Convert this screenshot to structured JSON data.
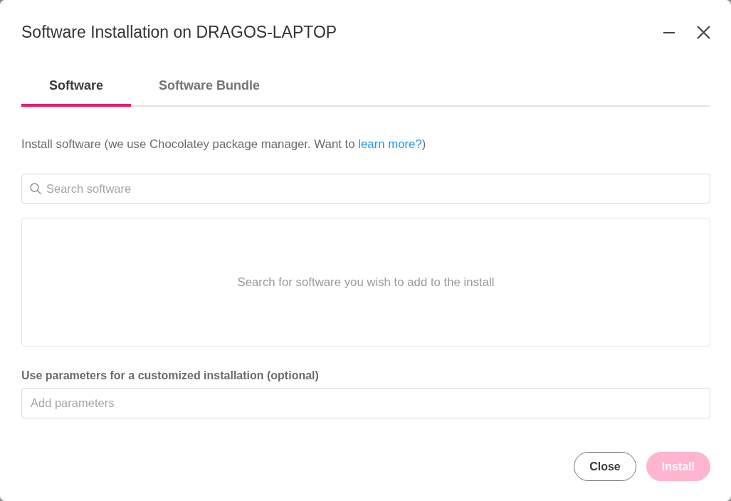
{
  "window": {
    "title": "Software Installation on DRAGOS-LAPTOP"
  },
  "tabs": [
    {
      "label": "Software",
      "selected": true
    },
    {
      "label": "Software Bundle",
      "selected": false
    }
  ],
  "description": {
    "text": "Install software (we use Chocolatey package manager. Want to ",
    "link": "learn more?",
    "suffix": ")"
  },
  "search": {
    "placeholder": "Search software"
  },
  "results": {
    "empty_message": "Search for software you wish to add to the install"
  },
  "parameters": {
    "label": "Use parameters for a customized installation (optional)",
    "placeholder": "Add parameters"
  },
  "buttons": [
    {
      "label": "Close",
      "kind": "secondary",
      "disabled": false
    },
    {
      "label": "Install",
      "kind": "primary",
      "disabled": true
    }
  ]
}
